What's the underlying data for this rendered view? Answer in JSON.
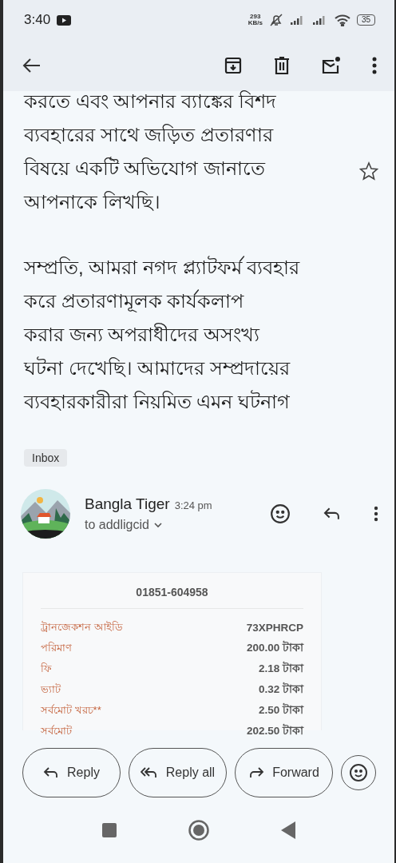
{
  "status_bar": {
    "time": "3:40",
    "net_speed": [
      "293",
      "KB/s"
    ],
    "battery": "35"
  },
  "body": {
    "paragraphs": [
      [
        "করতে এবং আপনার ব্যাঙ্কের বিশদ",
        "ব্যবহারের সাথে জড়িত প্রতারণার",
        "বিষয়ে একটি অভিযোগ জানাতে",
        "আপনাকে লিখছি।"
      ],
      [
        "সম্প্রতি, আমরা নগদ প্ল্যাটফর্ম ব্যবহার",
        "করে প্রতারণামূলক কার্যকলাপ",
        "করার জন্য অপরাধীদের অসংখ্য",
        "ঘটনা দেখেছি। আমাদের সম্প্রদায়ের",
        "ব্যবহারকারীরা নিয়মিত এমন ঘটনাগ"
      ]
    ],
    "starred": false,
    "label": "Inbox"
  },
  "message": {
    "sender": "Bangla Tiger",
    "time": "3:24 pm",
    "recipient": "to addligcid",
    "receipt": {
      "phone": "01851-604958",
      "rows": [
        {
          "label": "ট্রানজেকশন আইডি",
          "value": "73XPHRCP"
        },
        {
          "label": "পরিমাণ",
          "value": "200.00 টাকা"
        },
        {
          "label": "ফি",
          "value": "2.18 টাকা"
        },
        {
          "label": "ভ্যাট",
          "value": "0.32 টাকা"
        },
        {
          "label": "সর্বমোট খরচ**",
          "value": "2.50 টাকা"
        },
        {
          "label": "সর্বমোট",
          "value": "202.50 টাকা"
        }
      ]
    }
  },
  "actions": [
    {
      "kind": "reply",
      "label": "Reply"
    },
    {
      "kind": "reply_all",
      "label": "Reply all"
    },
    {
      "kind": "forward",
      "label": "Forward"
    },
    {
      "kind": "react"
    }
  ]
}
